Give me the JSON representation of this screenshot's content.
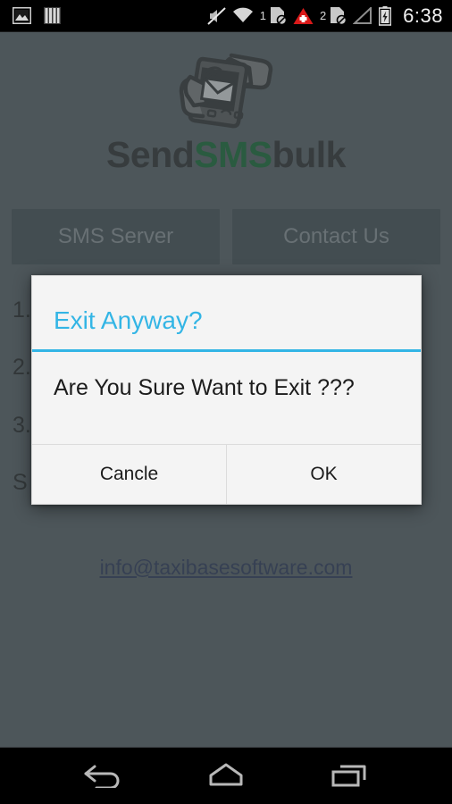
{
  "status_bar": {
    "left_icons": [
      {
        "name": "screenshot-icon",
        "label": "screenshot"
      },
      {
        "name": "bars-icon",
        "label": "bars"
      }
    ],
    "right_icons": [
      {
        "name": "volume-mute-icon",
        "label": "silent"
      },
      {
        "name": "wifi-icon",
        "label": "wifi"
      },
      {
        "name": "sim1-no-service-icon",
        "label": "SIM 1 no service",
        "badge": "1"
      },
      {
        "name": "warning-triangle-icon",
        "label": "alert"
      },
      {
        "name": "sim2-no-service-icon",
        "label": "SIM 2 no service",
        "badge": "2"
      },
      {
        "name": "signal-bars-icon",
        "label": "signal"
      },
      {
        "name": "battery-charging-icon",
        "label": "battery charging"
      }
    ],
    "clock": "6:38"
  },
  "app": {
    "logo": {
      "icon_name": "hand-holding-phone-message-icon",
      "text_part1": "Send",
      "text_part2": "SMS",
      "text_part3": "bulk",
      "color_dark": "#262626",
      "color_green": "#0b6b2a"
    },
    "buttons": [
      {
        "name": "sms-server-button",
        "label": "SMS Server"
      },
      {
        "name": "contact-us-button",
        "label": "Contact Us"
      }
    ],
    "instructions": [
      "1.",
      "2.",
      "3.",
      "S"
    ],
    "email_link": "info@taxibasesoftware.com",
    "background_color": "#586064",
    "button_color": "#404c51"
  },
  "dialog": {
    "title": "Exit Anyway?",
    "title_color": "#33b5e5",
    "message": "Are You Sure Want to Exit ???",
    "cancel_label": "Cancle",
    "ok_label": "OK"
  },
  "nav_bar": {
    "back_label": "Back",
    "home_label": "Home",
    "recents_label": "Recent apps"
  }
}
